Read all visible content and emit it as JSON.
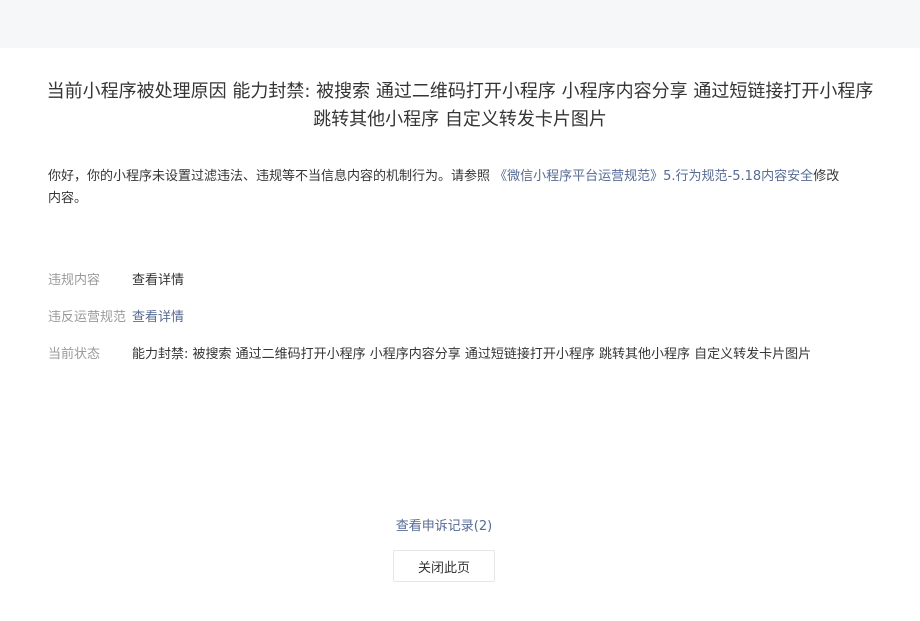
{
  "header": {
    "title": "当前小程序被处理原因 能力封禁: 被搜索 通过二维码打开小程序 小程序内容分享 通过短链接打开小程序 跳转其他小程序 自定义转发卡片图片"
  },
  "notice": {
    "text_prefix": "你好，你的小程序未设置过滤违法、违规等不当信息内容的机制行为。请参照 ",
    "link_text": "《微信小程序平台运营规范》5.行为规范-5.18内容安全",
    "text_suffix": "修改内容。"
  },
  "details": {
    "rows": [
      {
        "label": "违规内容",
        "value": "查看详情"
      },
      {
        "label": "违反运营规范",
        "value": "查看详情"
      },
      {
        "label": "当前状态",
        "value": "能力封禁: 被搜索 通过二维码打开小程序 小程序内容分享 通过短链接打开小程序 跳转其他小程序 自定义转发卡片图片"
      }
    ]
  },
  "footer": {
    "appeal_link": "查看申诉记录(2)",
    "close_button": "关闭此页"
  },
  "colors": {
    "link": "#576b95",
    "text": "#353535",
    "label": "#9a9a9a",
    "topbar": "#f6f7f9"
  }
}
